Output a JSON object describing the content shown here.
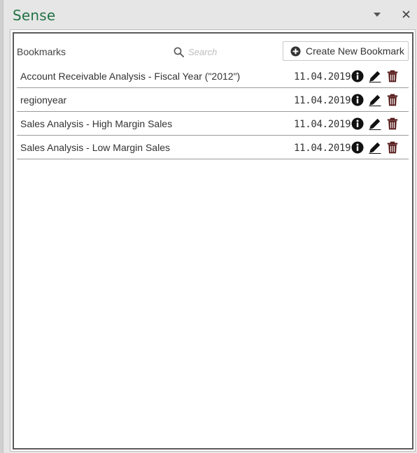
{
  "pane": {
    "title": "Sense",
    "menu_icon": "chevron-down-icon",
    "close_icon": "close-icon",
    "title_color": "#217346"
  },
  "toolbar": {
    "section_label": "Bookmarks",
    "search_placeholder": "Search",
    "search_value": "",
    "create_button_label": "Create New Bookmark"
  },
  "bookmarks": [
    {
      "title": "Account Receivable Analysis - Fiscal Year (\"2012\")",
      "date": "11.04.2019"
    },
    {
      "title": "regionyear",
      "date": "11.04.2019"
    },
    {
      "title": "Sales Analysis - High Margin Sales",
      "date": "11.04.2019"
    },
    {
      "title": "Sales Analysis - Low Margin Sales",
      "date": "11.04.2019"
    }
  ],
  "row_action_icons": [
    "info-icon",
    "pencil-icon",
    "trash-icon"
  ]
}
